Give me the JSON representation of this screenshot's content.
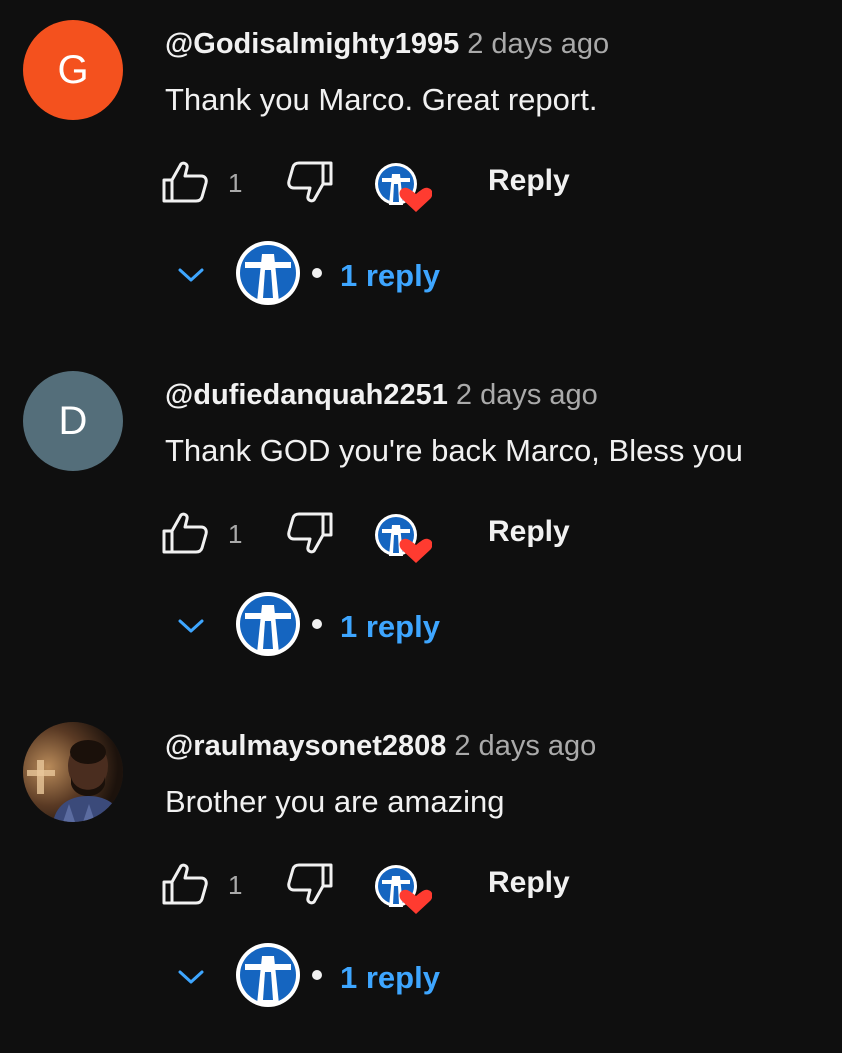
{
  "comments": [
    {
      "avatar_letter": "G",
      "avatar_color": "#f4511e",
      "author": "@Godisalmighty1995",
      "time": "2 days ago",
      "text": "Thank you Marco. Great report.",
      "likes": "1",
      "reply_label": "Reply",
      "replies": "1 reply"
    },
    {
      "avatar_letter": "D",
      "avatar_color": "#546e7a",
      "author": "@dufiedanquah2251",
      "time": "2 days ago",
      "text": "Thank GOD you're back Marco,  Bless you",
      "likes": "1",
      "reply_label": "Reply",
      "replies": "1 reply"
    },
    {
      "avatar_letter": "",
      "avatar_color": "#2a1f18",
      "author": "@raulmaysonet2808",
      "time": "2 days ago",
      "text": "Brother you are amazing",
      "likes": "1",
      "reply_label": "Reply",
      "replies": "1 reply"
    }
  ],
  "colors": {
    "background": "#0f0f0f",
    "reply_link": "#3ea6ff",
    "heart": "#ff3b30",
    "channel_blue": "#1565c0",
    "secondary_text": "#aaaaaa"
  },
  "icons": {
    "like": "thumbs-up-icon",
    "dislike": "thumbs-down-icon",
    "creator_heart": "creator-heart-icon",
    "expand": "chevron-down-icon",
    "channel_avatar": "lighthouse-avatar-icon"
  }
}
